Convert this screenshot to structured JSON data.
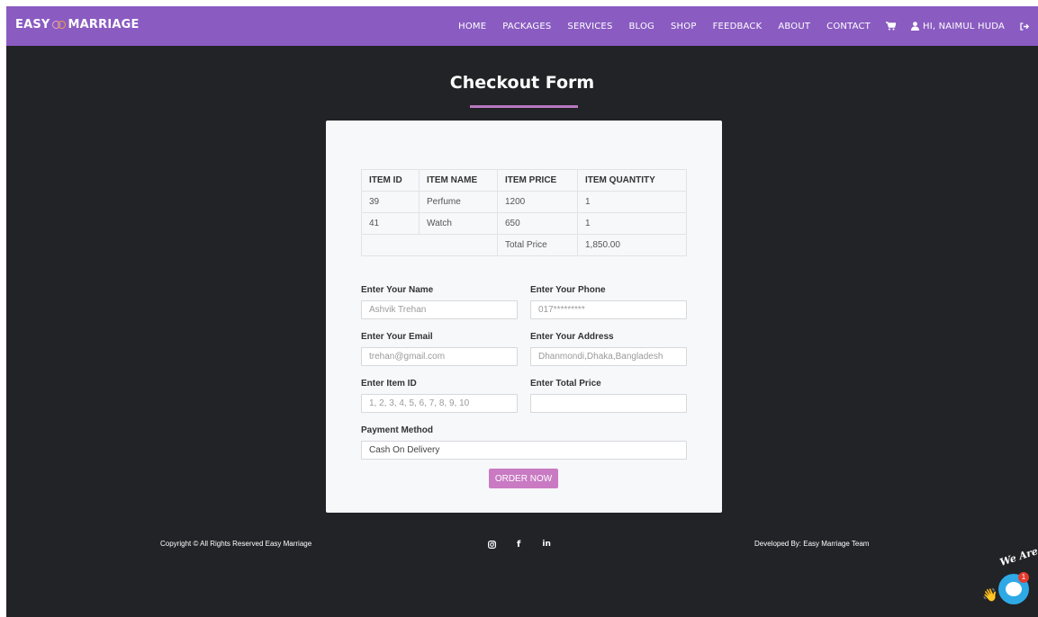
{
  "brand": {
    "name_left": "EASY",
    "name_right": "MARRIAGE"
  },
  "nav": {
    "items": [
      "HOME",
      "PACKAGES",
      "SERVICES",
      "BLOG",
      "SHOP",
      "FEEDBACK",
      "ABOUT",
      "CONTACT"
    ],
    "user_greeting": "HI, NAIMUL HUDA"
  },
  "page": {
    "title": "Checkout Form"
  },
  "cart_table": {
    "headers": [
      "ITEM ID",
      "ITEM NAME",
      "ITEM PRICE",
      "ITEM QUANTITY"
    ],
    "rows": [
      [
        "39",
        "Perfume",
        "1200",
        "1"
      ],
      [
        "41",
        "Watch",
        "650",
        "1"
      ]
    ],
    "total_label": "Total Price",
    "total_value": "1,850.00"
  },
  "form": {
    "name": {
      "label": "Enter Your Name",
      "placeholder": "Ashvik Trehan"
    },
    "phone": {
      "label": "Enter Your Phone",
      "placeholder": "017*********"
    },
    "email": {
      "label": "Enter Your Email",
      "placeholder": "trehan@gmail.com"
    },
    "address": {
      "label": "Enter Your Address",
      "placeholder": "Dhanmondi,Dhaka,Bangladesh"
    },
    "item_id": {
      "label": "Enter Item ID",
      "placeholder": "1, 2, 3, 4, 5, 6, 7, 8, 9, 10"
    },
    "total_price": {
      "label": "Enter Total Price",
      "placeholder": ""
    },
    "payment": {
      "label": "Payment Method",
      "value": "Cash On Delivery"
    },
    "submit_label": "ORDER NOW"
  },
  "footer": {
    "copyright": "Copyright © All Rights Reserved Easy Marriage",
    "developer": "Developed By: Easy Marriage Team",
    "socials": [
      "instagram-icon",
      "facebook-icon",
      "linkedin-icon"
    ],
    "linkedin_text": "in",
    "facebook_text": "f"
  },
  "chat": {
    "label": "We Are Here!",
    "badge_count": "1"
  },
  "colors": {
    "navbar": "#8a5bc1",
    "background": "#222326",
    "accent": "#c97ac3",
    "chat": "#2ea9e6"
  }
}
